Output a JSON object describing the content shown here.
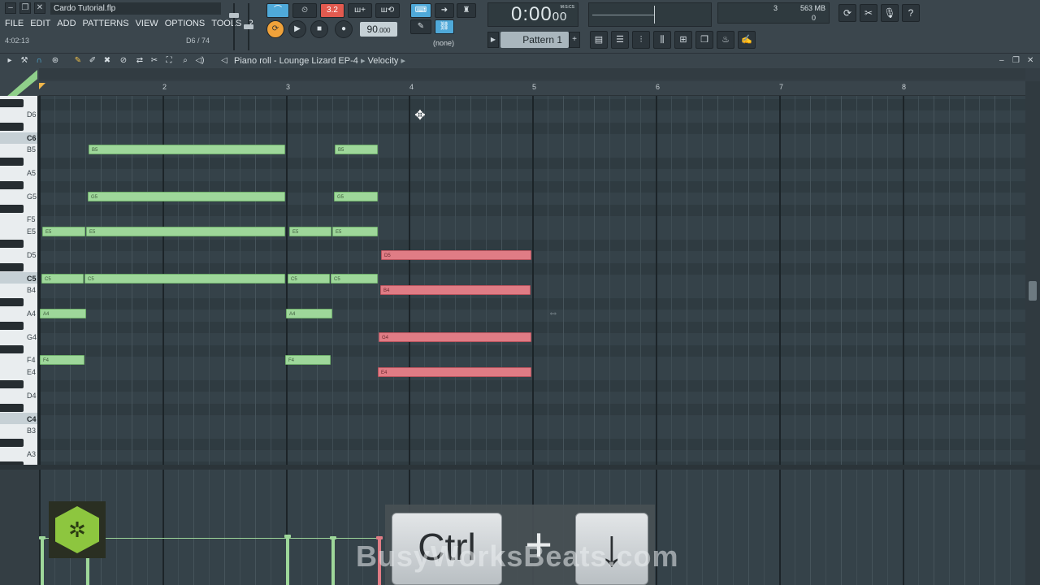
{
  "window": {
    "project_title": "Cardo Tutorial.flp",
    "hint_left": "4:02:13",
    "hint_right": "D6 / 74"
  },
  "menu": [
    "FILE",
    "EDIT",
    "ADD",
    "PATTERNS",
    "VIEW",
    "OPTIONS",
    "TOOLS",
    "?"
  ],
  "transport": {
    "tempo": "90",
    "tempo_decimal": ".000",
    "time": "0:00",
    "time_small": "00",
    "time_unit": "M:S:CS",
    "pattern": "Pattern 1",
    "channel": "(none)",
    "snap_label": "3.2"
  },
  "monitor": {
    "voices": "3",
    "memory": "563 MB",
    "cpu": "0"
  },
  "piano_roll": {
    "title": "Piano roll - Lounge Lizard EP-4",
    "target": "Velocity",
    "bars": [
      "2",
      "3",
      "4",
      "5",
      "6",
      "7",
      "8"
    ],
    "keys": [
      "D6",
      "C6",
      "B5",
      "A5",
      "G5",
      "F5",
      "E5",
      "D5",
      "C5",
      "B4",
      "A4",
      "G4",
      "F4",
      "E4",
      "D4",
      "C4",
      "B3",
      "A3"
    ],
    "notes_green": [
      {
        "label": "B5"
      },
      {
        "label": "B5"
      },
      {
        "label": "G5"
      },
      {
        "label": "G5"
      },
      {
        "label": "E5"
      },
      {
        "label": "E5"
      },
      {
        "label": "E5"
      },
      {
        "label": "E5"
      },
      {
        "label": "C5"
      },
      {
        "label": "C5"
      },
      {
        "label": "C5"
      },
      {
        "label": "C5"
      },
      {
        "label": "A4"
      },
      {
        "label": "A4"
      },
      {
        "label": "F4"
      },
      {
        "label": "F4"
      }
    ],
    "notes_red": [
      {
        "label": "D5"
      },
      {
        "label": "B4"
      },
      {
        "label": "G4"
      },
      {
        "label": "E4"
      }
    ]
  },
  "overlay": {
    "key1": "Ctrl",
    "plus": "+",
    "key2": "↓",
    "watermark": "BusyWorksBeats.com"
  },
  "colors": {
    "note_green": "#9ed79a",
    "note_red": "#e07c85",
    "accent_blue": "#4fa9d9"
  }
}
